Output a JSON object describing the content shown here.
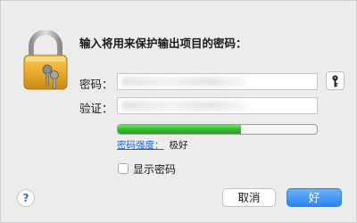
{
  "dialog": {
    "title": "输入将用来保护输出项目的密码：",
    "lock_icon": "padlock-with-keys-icon",
    "password_label": "密码：",
    "password_value": "",
    "verify_label": "验证：",
    "verify_value": "",
    "key_button_icon": "key-icon",
    "strength": {
      "link_label": "密码强度：",
      "value_label": "极好",
      "fill_fraction": 0.62,
      "fill_color": "#2fba2a"
    },
    "show_password": {
      "label": "显示密码",
      "checked": false
    },
    "help_button_label": "?",
    "cancel_label": "取消",
    "ok_label": "好",
    "accent_color": "#2a84f2"
  }
}
